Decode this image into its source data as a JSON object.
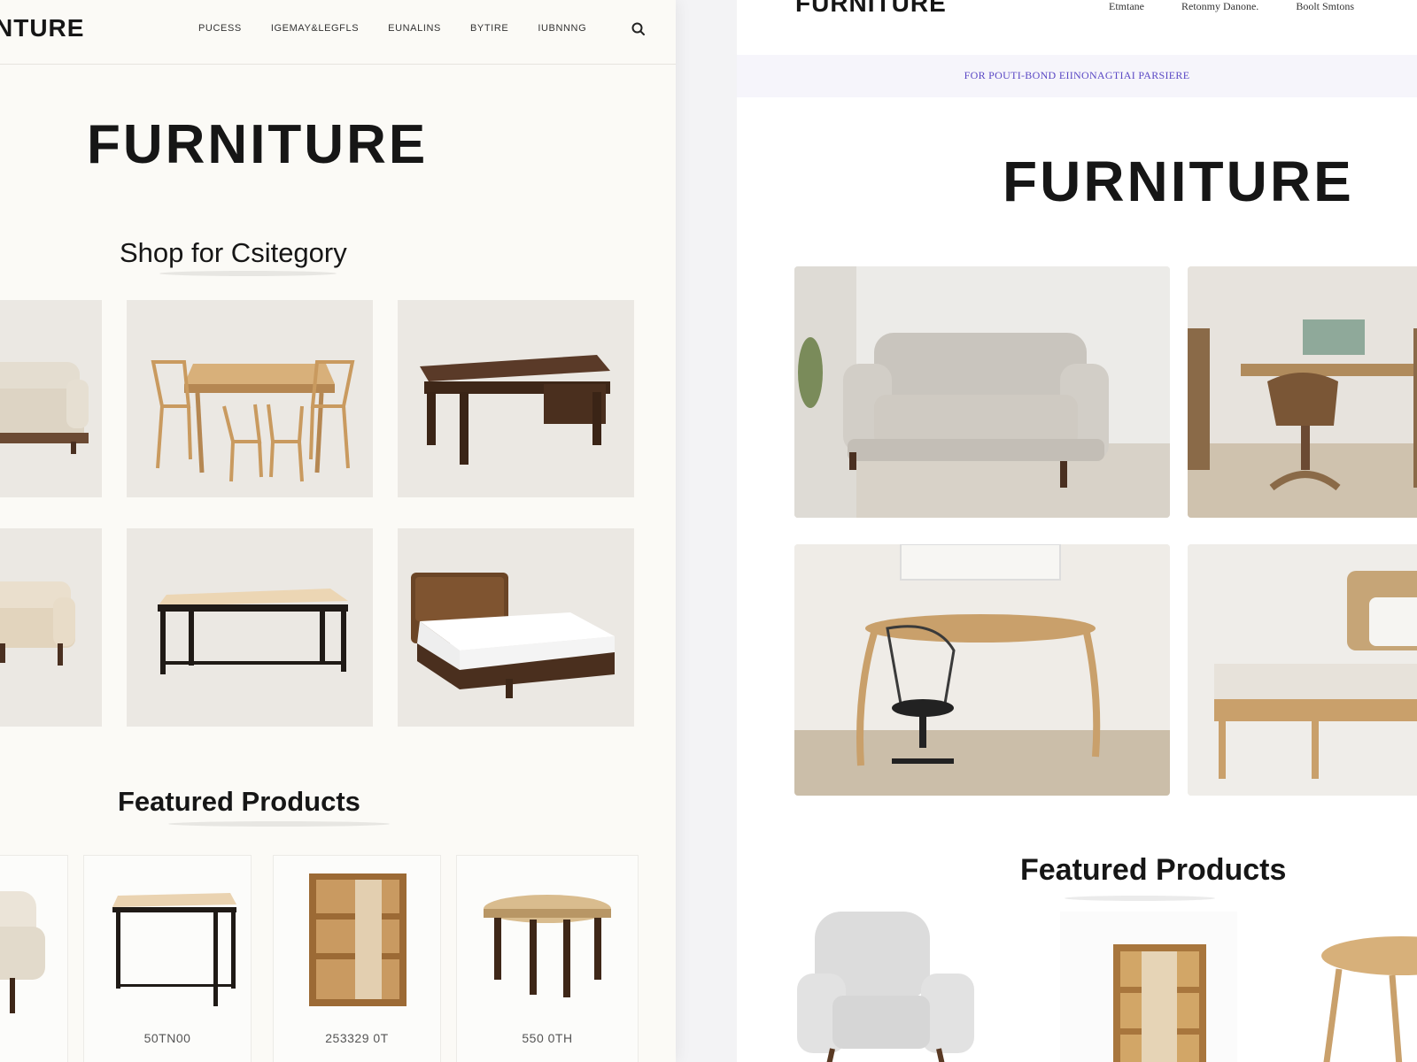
{
  "left_page": {
    "logo": "NTURE",
    "nav": [
      "PUCESS",
      "IGEMAY&LEGFLS",
      "EUNALINS",
      "BYTIRE",
      "IUBNNNG"
    ],
    "title": "FURNITURE",
    "subtitle": "Shop for Csitegory",
    "categories": [
      {
        "icon": "sofa-icon"
      },
      {
        "icon": "dining-set-icon"
      },
      {
        "icon": "dark-desk-icon"
      },
      {
        "icon": "loveseat-icon"
      },
      {
        "icon": "table-icon"
      },
      {
        "icon": "bed-icon"
      }
    ],
    "featured_title": "Featured Products",
    "products": [
      {
        "icon": "armchair-icon",
        "price": ""
      },
      {
        "icon": "side-table-icon",
        "price": "50TN00"
      },
      {
        "icon": "bookshelf-icon",
        "price": "253329 0T"
      },
      {
        "icon": "round-table-icon",
        "price": "550 0TH"
      }
    ]
  },
  "right_page": {
    "logo": "FURNITURE",
    "nav": [
      "Etmtane",
      "Retonmy Danone.",
      "Boolt Smtons"
    ],
    "promo": "FOR POUTI-BOND EIINONAGTIAI PARSIERE",
    "title": "FURNITURE",
    "photos": [
      {
        "icon": "living-room-sofa-icon"
      },
      {
        "icon": "dining-room-icon"
      },
      {
        "icon": "desk-chair-room-icon"
      },
      {
        "icon": "bedroom-icon"
      }
    ],
    "featured_title": "Featured Products",
    "products": [
      {
        "icon": "armchair-icon"
      },
      {
        "icon": "bookshelf-icon"
      },
      {
        "icon": "round-table-icon"
      }
    ]
  },
  "colors": {
    "accent": "#5a48c4",
    "text": "#161616",
    "tile_bg": "#ebe8e3",
    "wood_light": "#c9a06b",
    "wood_dark": "#4a3021"
  }
}
